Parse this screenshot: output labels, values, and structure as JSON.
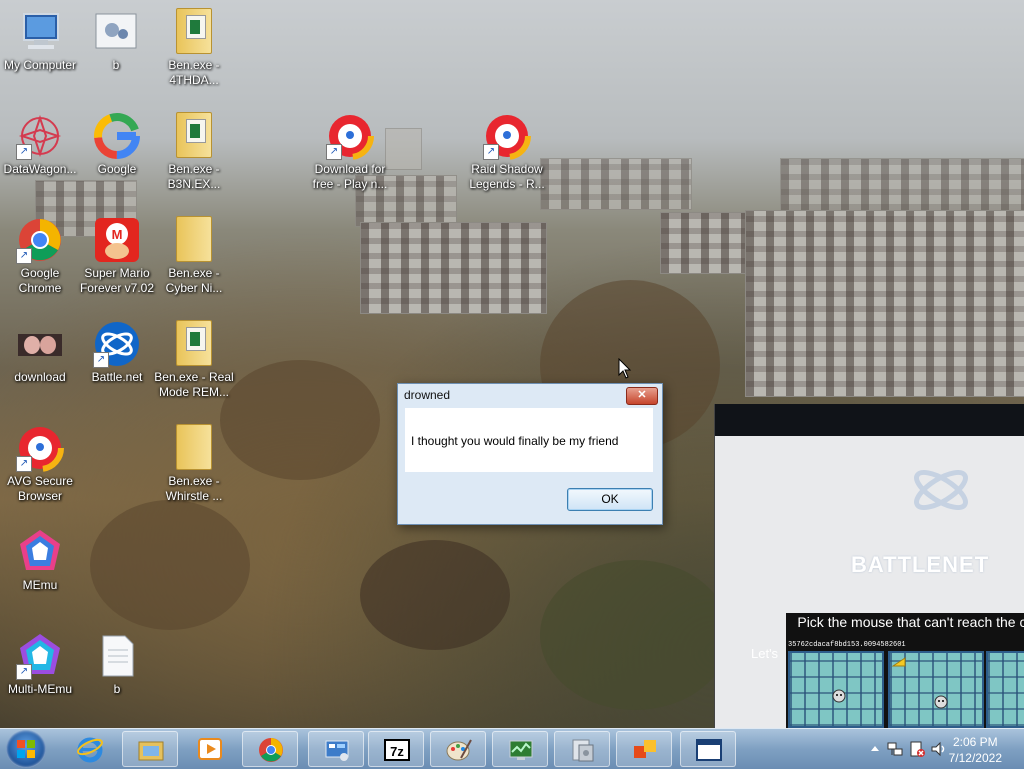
{
  "desktop": {
    "icons": [
      {
        "label": "My Computer",
        "icon": "computer-icon"
      },
      {
        "label": "b",
        "icon": "settings-file-icon"
      },
      {
        "label": "Ben.exe -\n4THDA...",
        "icon": "folder-icon"
      },
      {
        "label": "DataWagon...",
        "icon": "datawagon-icon"
      },
      {
        "label": "Google",
        "icon": "google-icon"
      },
      {
        "label": "Ben.exe -\nB3N.EX...",
        "icon": "folder-icon"
      },
      {
        "label": "Download for\nfree - Play n...",
        "icon": "avg-browser-icon"
      },
      {
        "label": "Raid Shadow\nLegends - R...",
        "icon": "avg-browser-icon"
      },
      {
        "label": "Google\nChrome",
        "icon": "chrome-icon"
      },
      {
        "label": "Super Mario\nForever v7.02",
        "icon": "mario-icon"
      },
      {
        "label": "Ben.exe -\nCyber Ni...",
        "icon": "folder-icon"
      },
      {
        "label": "download",
        "icon": "image-thumb-icon"
      },
      {
        "label": "Battle.net",
        "icon": "battlenet-icon"
      },
      {
        "label": "Ben.exe - Real\nMode REM...",
        "icon": "folder-icon"
      },
      {
        "label": "AVG Secure\nBrowser",
        "icon": "avg-browser-icon"
      },
      {
        "label": "Ben.exe -\nWhirstle ...",
        "icon": "folder-icon"
      },
      {
        "label": "MEmu",
        "icon": "memu-icon"
      },
      {
        "label": "Multi-MEmu",
        "icon": "multi-memu-icon"
      },
      {
        "label": "b",
        "icon": "text-file-icon"
      }
    ]
  },
  "dialog": {
    "title": "drowned",
    "close_label": "✕",
    "message": "I thought you would finally be my friend",
    "ok_label": "OK"
  },
  "battlenet": {
    "brand": "BATTLENET",
    "partial_text": "Let's"
  },
  "game": {
    "question": "Pick the mouse that can't reach the cheese",
    "hash": "35762cdacaf8bd153.0094582601"
  },
  "taskbar": {
    "apps": [
      "internet-explorer-icon",
      "file-explorer-icon",
      "media-player-icon",
      "chrome-icon",
      "control-panel-icon",
      "7zip-icon",
      "paint-icon",
      "system-monitor-icon",
      "installer-icon",
      "office-icon",
      "window-icon"
    ],
    "clock_time": "2:06 PM",
    "clock_date": "7/12/2022"
  }
}
